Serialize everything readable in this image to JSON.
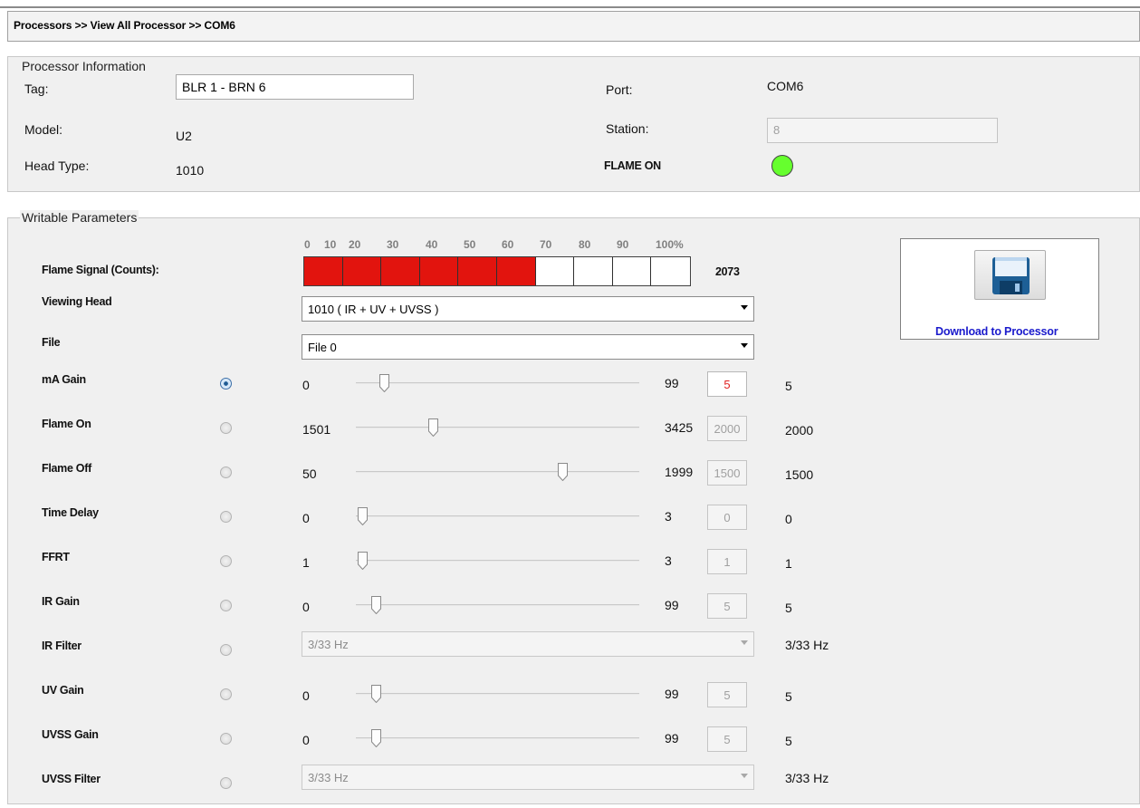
{
  "breadcrumb": "Processors >> View All Processor >> COM6",
  "processor_info": {
    "legend": "Processor Information",
    "tag_label": "Tag:",
    "tag_value": "BLR 1 - BRN 6",
    "model_label": "Model:",
    "model_value": "U2",
    "head_type_label": "Head Type:",
    "head_type_value": "1010",
    "port_label": "Port:",
    "port_value": "COM6",
    "station_label": "Station:",
    "station_value": "8",
    "flame_status_label": "FLAME ON",
    "flame_led_color": "#66ff2e"
  },
  "writable": {
    "legend": "Writable Parameters",
    "scale_labels": [
      "0",
      "10",
      "20",
      "30",
      "40",
      "50",
      "60",
      "70",
      "80",
      "90",
      "100%"
    ],
    "flame_signal_label": "Flame Signal (Counts):",
    "flame_signal_fraction": 0.6,
    "flame_signal_value": "2073",
    "viewing_head_label": "Viewing Head",
    "viewing_head_value": "1010 ( IR + UV + UVSS )",
    "file_label": "File",
    "file_value": "File 0",
    "params": [
      {
        "label": "mA Gain",
        "selected": true,
        "min": "0",
        "max": "99",
        "box": "5",
        "current": "5",
        "fraction": 0.08
      },
      {
        "label": "Flame On",
        "selected": false,
        "min": "1501",
        "max": "3425",
        "box": "2000",
        "current": "2000",
        "fraction": 0.26
      },
      {
        "label": "Flame Off",
        "selected": false,
        "min": "50",
        "max": "1999",
        "box": "1500",
        "current": "1500",
        "fraction": 0.74
      },
      {
        "label": "Time Delay",
        "selected": false,
        "min": "0",
        "max": "3",
        "box": "0",
        "current": "0",
        "fraction": 0.0
      },
      {
        "label": "FFRT",
        "selected": false,
        "min": "1",
        "max": "3",
        "box": "1",
        "current": "1",
        "fraction": 0.0
      },
      {
        "label": "IR Gain",
        "selected": false,
        "min": "0",
        "max": "99",
        "box": "5",
        "current": "5",
        "fraction": 0.05
      },
      {
        "label": "IR Filter",
        "selected": false,
        "dropdown": "3/33 Hz",
        "current": "3/33 Hz"
      },
      {
        "label": "UV Gain",
        "selected": false,
        "min": "0",
        "max": "99",
        "box": "5",
        "current": "5",
        "fraction": 0.05
      },
      {
        "label": "UVSS Gain",
        "selected": false,
        "min": "0",
        "max": "99",
        "box": "5",
        "current": "5",
        "fraction": 0.05
      },
      {
        "label": "UVSS Filter",
        "selected": false,
        "dropdown": "3/33 Hz",
        "current": "3/33 Hz"
      }
    ]
  },
  "download": {
    "label": "Download to Processor",
    "icon": "floppy-disk-icon"
  }
}
